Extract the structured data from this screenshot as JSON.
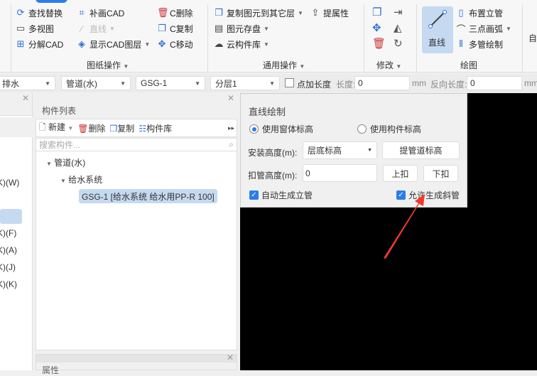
{
  "ribbon": {
    "drawing_ops": {
      "label": "图纸操作",
      "items": [
        "查找替换",
        "多视图",
        "分解CAD",
        "补画CAD",
        "直线",
        "显示CAD图层",
        "C删除",
        "C复制",
        "C移动"
      ]
    },
    "common_ops": {
      "label": "通用操作",
      "items": [
        "复制图元到其它层",
        "图元存盘",
        "云构件库",
        "提属性"
      ]
    },
    "modify": {
      "label": "修改"
    },
    "draw": {
      "label": "绘图",
      "line": "直线",
      "items": [
        "布置立管",
        "三点画弧",
        "多管绘制"
      ]
    },
    "cut_label": "自"
  },
  "toolbar": {
    "type": "排水",
    "category": "管道(水)",
    "component": "GSG-1",
    "layer": "分层1",
    "add_length_label": "点加长度",
    "length_label": "长度:",
    "length_value": "0",
    "unit1": "mm",
    "reverse_label": "反向长度:",
    "reverse_value": "0",
    "unit2": "mm"
  },
  "left_panel": {
    "items": [
      "K)(W)",
      "K)(F)",
      "K)(A)",
      "K)(J)",
      "K)(K)"
    ]
  },
  "component_list": {
    "title": "构件列表",
    "new": "新建",
    "delete": "删除",
    "copy": "复制",
    "library": "构件库",
    "search_placeholder": "搜索构件...",
    "tree": {
      "root": "管道(水)",
      "child": "给水系统",
      "leaf": "GSG-1 [给水系统 给水用PP-R 100]"
    }
  },
  "properties": {
    "title": "属性"
  },
  "dialog": {
    "title": "直线绘制",
    "radio1": "使用窗体标高",
    "radio2": "使用构件标高",
    "install_label": "安装高度(m):",
    "install_value": "层底标高",
    "pick_btn": "提管道标高",
    "deduct_label": "扣管高度(m):",
    "deduct_value": "0",
    "up_btn": "上扣",
    "down_btn": "下扣",
    "auto_riser": "自动生成立管",
    "allow_slope": "允许生成斜管"
  },
  "colors": {
    "accent": "#2b7de9",
    "arrow": "#f03a2a"
  }
}
